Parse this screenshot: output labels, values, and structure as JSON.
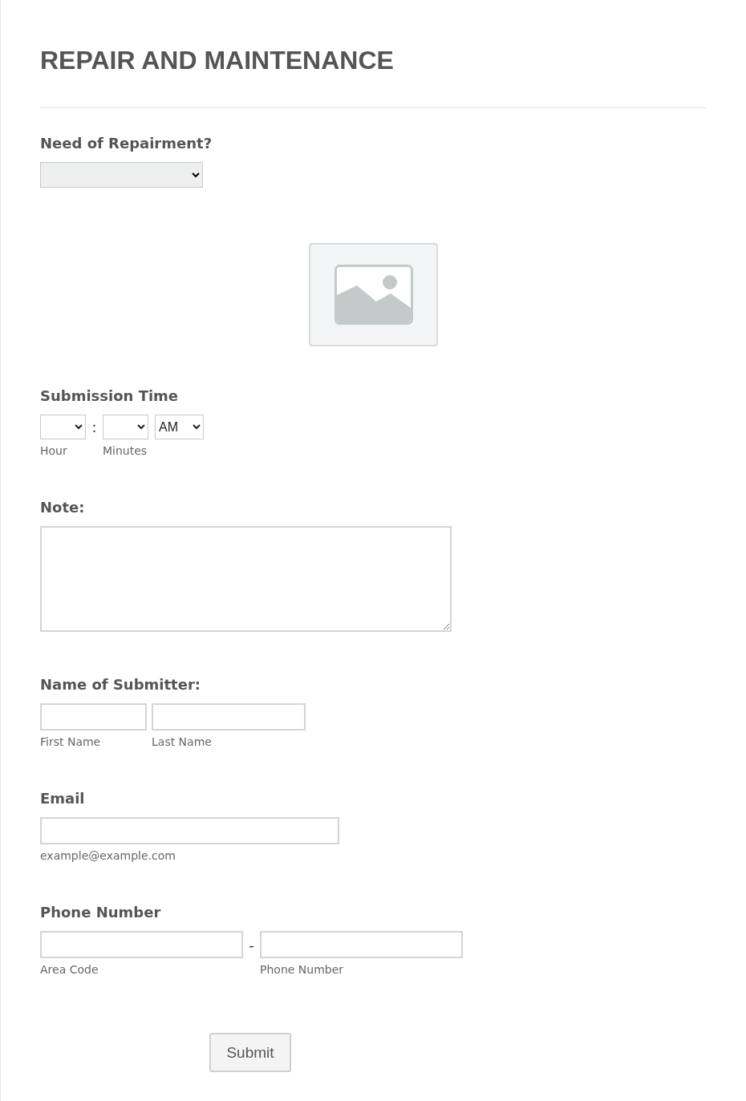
{
  "title": "REPAIR AND MAINTENANCE",
  "fields": [
    {
      "kind": "dropdown",
      "label": "Need of Repairment?"
    },
    {
      "kind": "image"
    },
    {
      "kind": "time",
      "label": "Submission Time",
      "separator": ":",
      "period": "AM",
      "sublabels": [
        "Hour",
        "Minutes"
      ]
    },
    {
      "kind": "textarea",
      "label": "Note:"
    },
    {
      "kind": "name",
      "label": "Name of Submitter:",
      "sublabels": [
        "First Name",
        "Last Name"
      ]
    },
    {
      "kind": "email",
      "label": "Email",
      "sublabels": [
        "example@example.com"
      ]
    },
    {
      "kind": "phone",
      "label": "Phone Number",
      "separator": "-",
      "sublabels": [
        "Area Code",
        "Phone Number"
      ]
    }
  ],
  "submit": "Submit"
}
